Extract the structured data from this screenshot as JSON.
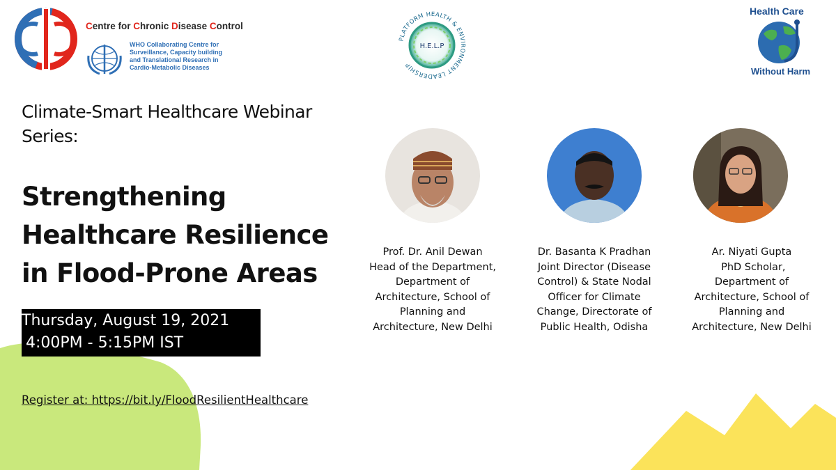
{
  "logos": {
    "ccdc": {
      "name_parts": [
        {
          "text": "C",
          "hl": true
        },
        {
          "text": "entre for ",
          "hl": false
        },
        {
          "text": "C",
          "hl": true
        },
        {
          "text": "hronic ",
          "hl": false
        },
        {
          "text": "D",
          "hl": true
        },
        {
          "text": "isease ",
          "hl": false
        },
        {
          "text": "C",
          "hl": true
        },
        {
          "text": "ontrol",
          "hl": false
        }
      ],
      "who_lines": [
        "WHO Collaborating Centre for",
        "Surveillance, Capacity building",
        "and Translational Research in",
        "Cardio-Metabolic Diseases"
      ],
      "icon": "ccdc-logo-icon",
      "red": "#e1261c",
      "blue": "#2f6fb5"
    },
    "help": {
      "center": "H.E.L.P",
      "ring_text": "PLATFORM HEALTH & ENVIRONMENT LEADERSHIP",
      "icon": "help-logo-icon"
    },
    "hcwh": {
      "top": "Health Care",
      "bottom": "Without Harm",
      "icon": "globe-icon"
    }
  },
  "series_lines": [
    "Climate-Smart Healthcare Webinar",
    "Series:"
  ],
  "title_lines": [
    "Strengthening",
    "Healthcare Resilience",
    "in Flood-Prone Areas"
  ],
  "date": {
    "line1": "Thursday, August 19, 2021",
    "line2": "4:00PM - 5:15PM IST"
  },
  "register": "Register at: https://bit.ly/FloodResilientHealthcare",
  "speakers": [
    {
      "lines": [
        "Prof. Dr. Anil Dewan",
        "Head of the Department,",
        "Department of",
        "Architecture, School of",
        "Planning and",
        "Architecture, New Delhi"
      ]
    },
    {
      "lines": [
        "Dr. Basanta K Pradhan",
        "Joint Director (Disease",
        "Control) & State Nodal",
        "Officer for Climate",
        "Change, Directorate of",
        "Public Health, Odisha"
      ]
    },
    {
      "lines": [
        "Ar. Niyati Gupta",
        " PhD Scholar,",
        "Department of",
        "Architecture, School of",
        "Planning and",
        "Architecture, New Delhi"
      ]
    }
  ],
  "colors": {
    "green_shape": "#c9e87c",
    "yellow_shape": "#fbe35a",
    "date_bg": "#000000",
    "hcwh_blue": "#1e4f8f"
  }
}
